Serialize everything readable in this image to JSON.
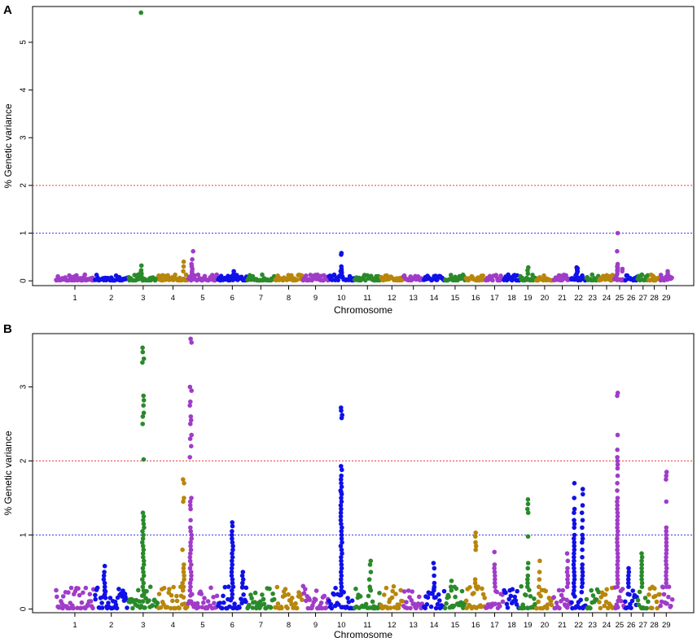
{
  "chart_data": [
    {
      "type": "scatter",
      "panel": "A",
      "xlabel": "Chromosome",
      "ylabel": "% Genetic variance",
      "ylim": [
        -0.1,
        5.75
      ],
      "yticks": [
        0,
        1,
        2,
        3,
        4,
        5
      ],
      "thresholds": [
        {
          "value": 2,
          "color": "#e8403a"
        },
        {
          "value": 1,
          "color": "#3b3bf0"
        }
      ],
      "grid": false,
      "baseline_max": 0.12,
      "peaks": [
        {
          "chromosome": 3,
          "pos": 0.45,
          "values": [
            5.62,
            0.32,
            0.22,
            0.18,
            0.15,
            0.12
          ]
        },
        {
          "chromosome": 4,
          "pos": 0.85,
          "values": [
            0.4,
            0.3,
            0.2
          ]
        },
        {
          "chromosome": 5,
          "pos": 0.15,
          "values": [
            0.62,
            0.45,
            0.35,
            0.3,
            0.25,
            0.2,
            0.18,
            0.15
          ]
        },
        {
          "chromosome": 6,
          "pos": 0.55,
          "values": [
            0.2,
            0.15
          ]
        },
        {
          "chromosome": 10,
          "pos": 0.5,
          "values": [
            0.58,
            0.55,
            0.3,
            0.25,
            0.22,
            0.2,
            0.18,
            0.15
          ]
        },
        {
          "chromosome": 19,
          "pos": 0.5,
          "values": [
            0.28,
            0.22,
            0.15
          ]
        },
        {
          "chromosome": 22,
          "pos": 0.4,
          "values": [
            0.28,
            0.26,
            0.25,
            0.22,
            0.2,
            0.18,
            0.15
          ]
        },
        {
          "chromosome": 25,
          "pos": 0.3,
          "values": [
            1.0,
            0.62,
            0.35,
            0.3,
            0.28,
            0.25,
            0.22,
            0.2,
            0.15
          ]
        },
        {
          "chromosome": 25,
          "pos": 0.75,
          "values": [
            0.25,
            0.2
          ]
        },
        {
          "chromosome": 29,
          "pos": 0.6,
          "values": [
            0.2,
            0.15
          ]
        }
      ]
    },
    {
      "type": "scatter",
      "panel": "B",
      "xlabel": "Chromosome",
      "ylabel": "% Genetic variance",
      "ylim": [
        -0.05,
        3.72
      ],
      "yticks": [
        0,
        1,
        2,
        3
      ],
      "thresholds": [
        {
          "value": 2,
          "color": "#e8403a"
        },
        {
          "value": 1,
          "color": "#3b3bf0"
        }
      ],
      "grid": false,
      "baseline_max": 0.3,
      "peaks": [
        {
          "chromosome": 2,
          "pos": 0.3,
          "values": [
            0.58,
            0.5,
            0.45,
            0.4,
            0.35,
            0.3,
            0.25,
            0.2,
            0.15
          ]
        },
        {
          "chromosome": 3,
          "pos": 0.5,
          "values": [
            3.53,
            3.47,
            3.38,
            3.33,
            2.88,
            2.82,
            2.75,
            2.65,
            2.6,
            2.5,
            2.02,
            1.3,
            1.25,
            1.2,
            1.15,
            1.1,
            1.05,
            1.0,
            0.95,
            0.9,
            0.85,
            0.8,
            0.75,
            0.7,
            0.65,
            0.6,
            0.55,
            0.5,
            0.45,
            0.4,
            0.35,
            0.3,
            0.25,
            0.2
          ]
        },
        {
          "chromosome": 4,
          "pos": 0.85,
          "values": [
            1.75,
            1.7,
            1.5,
            1.45,
            0.8,
            0.6,
            0.55,
            0.5,
            0.45,
            0.4,
            0.35,
            0.3,
            0.25
          ]
        },
        {
          "chromosome": 5,
          "pos": 0.1,
          "values": [
            3.65,
            3.6,
            3.0,
            2.95,
            2.8,
            2.75,
            2.6,
            2.55,
            2.5,
            2.35,
            2.3,
            2.2,
            2.05,
            1.5,
            1.45,
            1.4,
            1.35,
            1.2,
            1.1,
            1.05,
            1.0,
            0.95,
            0.9,
            0.85,
            0.8,
            0.75,
            0.7,
            0.65,
            0.6,
            0.55,
            0.5,
            0.45,
            0.4,
            0.35,
            0.3,
            0.25,
            0.2
          ]
        },
        {
          "chromosome": 6,
          "pos": 0.5,
          "values": [
            1.17,
            1.12,
            1.05,
            1.0,
            0.95,
            0.9,
            0.85,
            0.8,
            0.75,
            0.7,
            0.65,
            0.6,
            0.55,
            0.5,
            0.45,
            0.4,
            0.35,
            0.3,
            0.25,
            0.2
          ]
        },
        {
          "chromosome": 6,
          "pos": 0.85,
          "values": [
            0.5,
            0.45,
            0.4,
            0.35,
            0.3
          ]
        },
        {
          "chromosome": 10,
          "pos": 0.5,
          "values": [
            2.72,
            2.68,
            2.62,
            2.58,
            1.93,
            1.88,
            1.8,
            1.75,
            1.7,
            1.65,
            1.6,
            1.58,
            1.55,
            1.5,
            1.45,
            1.4,
            1.35,
            1.3,
            1.25,
            1.2,
            1.15,
            1.1,
            1.05,
            1.0,
            0.95,
            0.9,
            0.85,
            0.8,
            0.75,
            0.7,
            0.65,
            0.6,
            0.55,
            0.5,
            0.45,
            0.4,
            0.35,
            0.3,
            0.25,
            0.2
          ]
        },
        {
          "chromosome": 11,
          "pos": 0.6,
          "values": [
            0.65,
            0.6,
            0.5,
            0.4,
            0.3,
            0.25
          ]
        },
        {
          "chromosome": 14,
          "pos": 0.5,
          "values": [
            0.62,
            0.55,
            0.45,
            0.35,
            0.3,
            0.25
          ]
        },
        {
          "chromosome": 15,
          "pos": 0.3,
          "values": [
            0.38,
            0.3,
            0.25
          ]
        },
        {
          "chromosome": 16,
          "pos": 0.5,
          "values": [
            1.03,
            0.98,
            0.9,
            0.85,
            0.8,
            0.4,
            0.35,
            0.3
          ]
        },
        {
          "chromosome": 17,
          "pos": 0.5,
          "values": [
            0.77,
            0.6,
            0.55,
            0.5,
            0.45,
            0.4,
            0.35,
            0.3
          ]
        },
        {
          "chromosome": 19,
          "pos": 0.5,
          "values": [
            1.48,
            1.42,
            1.35,
            1.3,
            0.98,
            0.62,
            0.55,
            0.45,
            0.4,
            0.35,
            0.3
          ]
        },
        {
          "chromosome": 20,
          "pos": 0.2,
          "values": [
            0.65,
            0.5,
            0.4,
            0.3
          ]
        },
        {
          "chromosome": 21,
          "pos": 0.8,
          "values": [
            0.75,
            0.65,
            0.55,
            0.5,
            0.45,
            0.4,
            0.35,
            0.3
          ]
        },
        {
          "chromosome": 22,
          "pos": 0.2,
          "values": [
            1.7,
            1.5,
            1.35,
            1.3,
            1.2,
            1.15,
            1.1,
            1.0,
            0.95,
            0.9,
            0.85,
            0.8,
            0.75,
            0.7,
            0.65,
            0.6,
            0.55,
            0.5,
            0.45,
            0.4,
            0.35,
            0.3,
            0.25
          ]
        },
        {
          "chromosome": 22,
          "pos": 0.75,
          "values": [
            1.62,
            1.55,
            1.4,
            1.3,
            1.2,
            1.1,
            1.0,
            0.95,
            0.9,
            0.8,
            0.7,
            0.6,
            0.55,
            0.5,
            0.45,
            0.4,
            0.35,
            0.3
          ]
        },
        {
          "chromosome": 25,
          "pos": 0.3,
          "values": [
            2.92,
            2.88,
            2.35,
            2.15,
            2.05,
            2.0,
            1.95,
            1.9,
            1.8,
            1.7,
            1.6,
            1.5,
            1.45,
            1.4,
            1.35,
            1.3,
            1.25,
            1.2,
            1.15,
            1.1,
            1.05,
            1.0,
            0.95,
            0.9,
            0.85,
            0.8,
            0.75,
            0.7,
            0.65,
            0.6,
            0.55,
            0.5,
            0.45,
            0.4,
            0.35,
            0.3
          ]
        },
        {
          "chromosome": 26,
          "pos": 0.3,
          "values": [
            0.55,
            0.5,
            0.45,
            0.4,
            0.35,
            0.3
          ]
        },
        {
          "chromosome": 27,
          "pos": 0.4,
          "values": [
            0.75,
            0.7,
            0.65,
            0.6,
            0.55,
            0.5,
            0.45,
            0.4,
            0.35,
            0.3
          ]
        },
        {
          "chromosome": 29,
          "pos": 0.5,
          "values": [
            1.85,
            1.8,
            1.75,
            1.45,
            1.1,
            1.05,
            1.0,
            0.95,
            0.9,
            0.85,
            0.8,
            0.75,
            0.7,
            0.65,
            0.6,
            0.55,
            0.5,
            0.45,
            0.4,
            0.35,
            0.3
          ]
        }
      ]
    }
  ],
  "chromosomes": [
    {
      "label": "1",
      "color": "#a03cc8",
      "size": 158
    },
    {
      "label": "2",
      "color": "#1010e8",
      "size": 137
    },
    {
      "label": "3",
      "color": "#2a8a2a",
      "size": 121
    },
    {
      "label": "4",
      "color": "#b8860b",
      "size": 120
    },
    {
      "label": "5",
      "color": "#a03cc8",
      "size": 121
    },
    {
      "label": "6",
      "color": "#1010e8",
      "size": 119
    },
    {
      "label": "7",
      "color": "#2a8a2a",
      "size": 112
    },
    {
      "label": "8",
      "color": "#b8860b",
      "size": 113
    },
    {
      "label": "9",
      "color": "#a03cc8",
      "size": 105
    },
    {
      "label": "10",
      "color": "#1010e8",
      "size": 104
    },
    {
      "label": "11",
      "color": "#2a8a2a",
      "size": 107
    },
    {
      "label": "12",
      "color": "#b8860b",
      "size": 91
    },
    {
      "label": "13",
      "color": "#a03cc8",
      "size": 83
    },
    {
      "label": "14",
      "color": "#1010e8",
      "size": 85
    },
    {
      "label": "15",
      "color": "#2a8a2a",
      "size": 85
    },
    {
      "label": "16",
      "color": "#b8860b",
      "size": 81
    },
    {
      "label": "17",
      "color": "#a03cc8",
      "size": 73
    },
    {
      "label": "18",
      "color": "#1010e8",
      "size": 66
    },
    {
      "label": "19",
      "color": "#2a8a2a",
      "size": 64
    },
    {
      "label": "20",
      "color": "#b8860b",
      "size": 72
    },
    {
      "label": "21",
      "color": "#a03cc8",
      "size": 71
    },
    {
      "label": "22",
      "color": "#1010e8",
      "size": 61
    },
    {
      "label": "23",
      "color": "#2a8a2a",
      "size": 52
    },
    {
      "label": "24",
      "color": "#b8860b",
      "size": 62
    },
    {
      "label": "25",
      "color": "#a03cc8",
      "size": 43
    },
    {
      "label": "26",
      "color": "#1010e8",
      "size": 51
    },
    {
      "label": "27",
      "color": "#2a8a2a",
      "size": 45
    },
    {
      "label": "28",
      "color": "#b8860b",
      "size": 46
    },
    {
      "label": "29",
      "color": "#a03cc8",
      "size": 51
    }
  ],
  "colors": {
    "purple": "#a03cc8",
    "blue": "#1010e8",
    "green": "#2a8a2a",
    "gold": "#b8860b",
    "threshold_2": "#e8403a",
    "threshold_1": "#3b3bf0"
  }
}
